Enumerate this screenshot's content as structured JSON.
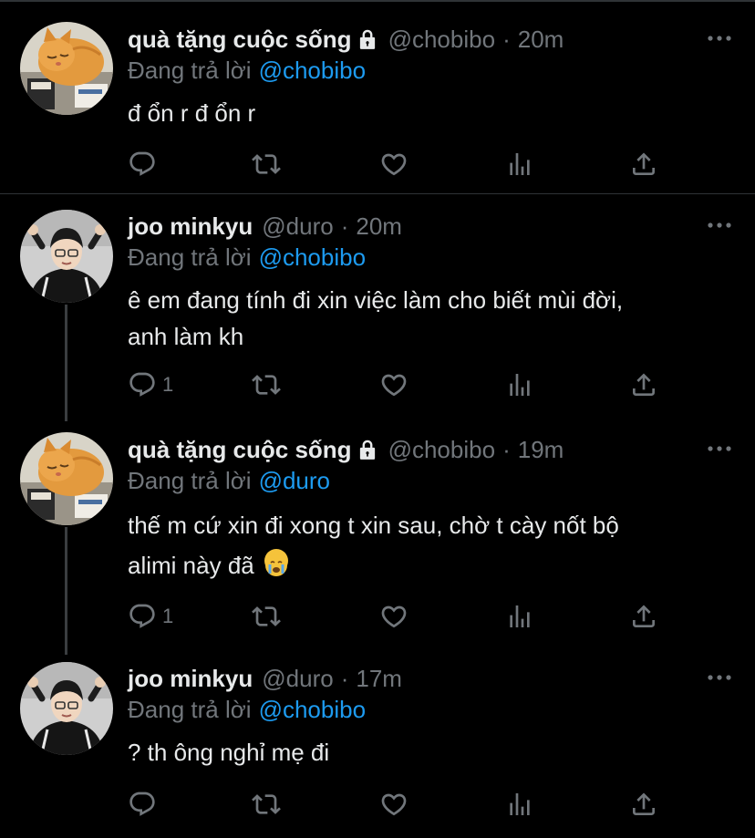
{
  "tweets": [
    {
      "name": "quà tặng cuộc sống",
      "locked": true,
      "handle": "@chobibo",
      "dot": "·",
      "time": "20m",
      "reply_prefix": "Đang trả lời",
      "reply_to": "@chobibo",
      "text": "đ ổn r đ ổn r",
      "reply_count": ""
    },
    {
      "name": "joo minkyu",
      "locked": false,
      "handle": "@duro",
      "dot": "·",
      "time": "20m",
      "reply_prefix": "Đang trả lời",
      "reply_to": "@chobibo",
      "text_line1": "ê em đang tính đi xin việc làm cho biết mùi đời,",
      "text_line2": "anh làm kh",
      "reply_count": "1"
    },
    {
      "name": "quà tặng cuộc sống",
      "locked": true,
      "handle": "@chobibo",
      "dot": "·",
      "time": "19m",
      "reply_prefix": "Đang trả lời",
      "reply_to": "@duro",
      "text_line1": "thế m cứ xin đi xong t xin sau, chờ t cày nốt bộ",
      "text_line2": "alimi này đã",
      "emoji": "loudly-crying-face",
      "reply_count": "1"
    },
    {
      "name": "joo minkyu",
      "locked": false,
      "handle": "@duro",
      "dot": "·",
      "time": "17m",
      "reply_prefix": "Đang trả lời",
      "reply_to": "@chobibo",
      "text": "? th ông nghỉ mẹ đi",
      "reply_count": ""
    }
  ],
  "icons": {
    "reply": "reply-icon",
    "retweet": "retweet-icon",
    "like": "heart-icon",
    "views": "analytics-icon",
    "share": "share-icon",
    "more": "more-icon",
    "lock": "lock-icon"
  },
  "colors": {
    "background": "#000000",
    "text": "#e7e9ea",
    "muted": "#71767b",
    "mention": "#1d9bf0",
    "divider": "#2f3336"
  }
}
